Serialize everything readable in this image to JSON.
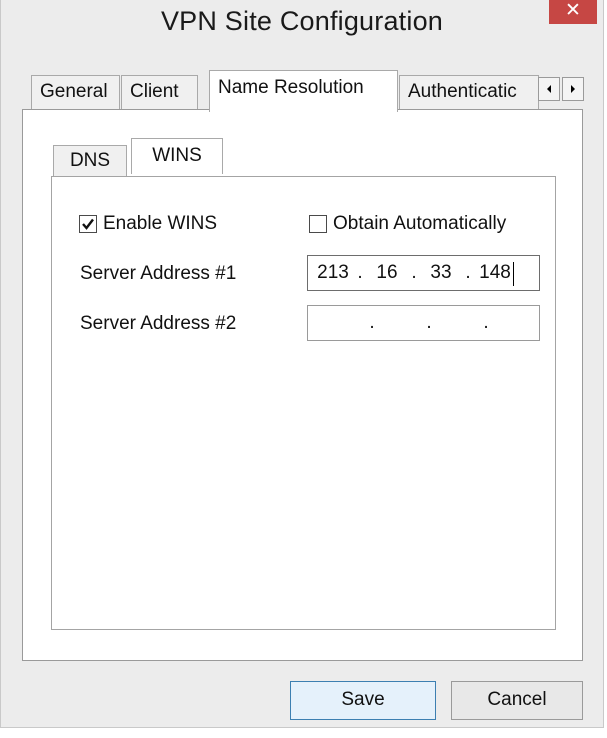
{
  "window": {
    "title": "VPN Site Configuration"
  },
  "titlebar": {
    "close_symbol": "✕"
  },
  "outer_tabs": [
    {
      "label": "General",
      "active": false
    },
    {
      "label": "Client",
      "active": false
    },
    {
      "label": "Name Resolution",
      "active": true
    },
    {
      "label": "Authenticatic",
      "active": false
    }
  ],
  "scroll": {
    "left_icon": "left-arrow-icon",
    "right_icon": "right-arrow-icon"
  },
  "inner_tabs": [
    {
      "label": "DNS",
      "active": false
    },
    {
      "label": "WINS",
      "active": true
    }
  ],
  "wins": {
    "enable": {
      "label": "Enable WINS",
      "checked": true
    },
    "obtain_auto": {
      "label": "Obtain Automatically",
      "checked": false
    },
    "server1": {
      "label": "Server Address #1",
      "octets": [
        "213",
        "16",
        "33",
        "148"
      ]
    },
    "server2": {
      "label": "Server Address #2",
      "octets": [
        "",
        "",
        "",
        ""
      ]
    }
  },
  "buttons": {
    "save": "Save",
    "cancel": "Cancel"
  },
  "colors": {
    "close_button": "#c64744",
    "default_button_border": "#3c7fb1"
  }
}
